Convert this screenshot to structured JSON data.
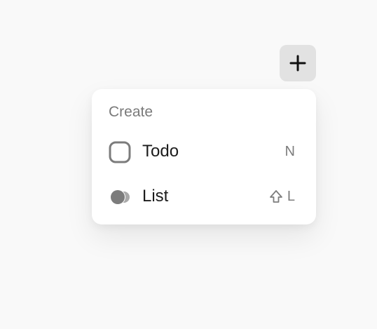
{
  "add_button": {
    "icon": "plus-icon"
  },
  "menu": {
    "title": "Create",
    "items": [
      {
        "label": "Todo",
        "shortcut": "N",
        "icon": "checkbox-icon"
      },
      {
        "label": "List",
        "shortcut_modifier_icon": "shift-icon",
        "shortcut": "L",
        "icon": "list-toggle-icon"
      }
    ]
  },
  "colors": {
    "background": "#f9f9f9",
    "button_bg": "#e2e2e2",
    "title_text": "#7a7a7a",
    "item_text": "#1c1c1c",
    "shortcut_text": "#7d7d7d",
    "icon_gray": "#7c7c7c"
  }
}
